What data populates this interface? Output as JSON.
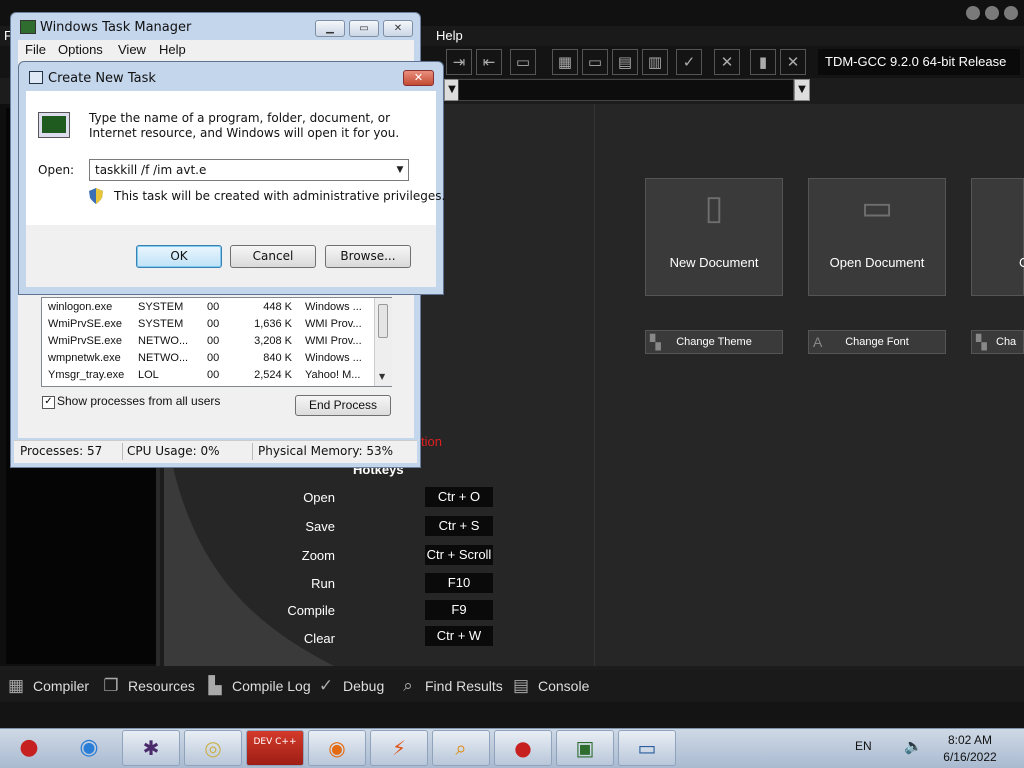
{
  "devcpp": {
    "menu": {
      "first": "F",
      "help": "Help"
    },
    "compiler": "TDM-GCC 9.2.0 64-bit Release",
    "cards": [
      {
        "label": "New Document",
        "icon": "new-document-icon"
      },
      {
        "label": "Open Document",
        "icon": "open-document-icon"
      },
      {
        "label": "C",
        "icon": "document-icon"
      }
    ],
    "small_buttons": [
      {
        "label": "Change Theme",
        "icon": "theme-icon"
      },
      {
        "label": "Change Font",
        "icon": "font-icon"
      },
      {
        "label": "Cha",
        "icon": "settings-icon"
      }
    ],
    "hotkeys_fragment": "tion",
    "hotkeys_title": "Hotkeys",
    "hotkeys": [
      {
        "action": "Open",
        "keys": "Ctr + O"
      },
      {
        "action": "Save",
        "keys": "Ctr + S"
      },
      {
        "action": "Zoom",
        "keys": "Ctr + Scroll"
      },
      {
        "action": "Run",
        "keys": "F10"
      },
      {
        "action": "Compile",
        "keys": "F9"
      },
      {
        "action": "Clear",
        "keys": "Ctr + W"
      }
    ],
    "bottom_tabs": [
      "Compiler",
      "Resources",
      "Compile Log",
      "Debug",
      "Find Results",
      "Console"
    ]
  },
  "task_manager": {
    "title": "Windows Task Manager",
    "menu": [
      "File",
      "Options",
      "View",
      "Help"
    ],
    "processes": [
      {
        "name": "winlogon.exe",
        "user": "SYSTEM",
        "cpu": "00",
        "mem": "448 K",
        "desc": "Windows ..."
      },
      {
        "name": "WmiPrvSE.exe",
        "user": "SYSTEM",
        "cpu": "00",
        "mem": "1,636 K",
        "desc": "WMI Prov..."
      },
      {
        "name": "WmiPrvSE.exe",
        "user": "NETWO...",
        "cpu": "00",
        "mem": "3,208 K",
        "desc": "WMI Prov..."
      },
      {
        "name": "wmpnetwk.exe",
        "user": "NETWO...",
        "cpu": "00",
        "mem": "840 K",
        "desc": "Windows ..."
      },
      {
        "name": "Ymsgr_tray.exe",
        "user": "LOL",
        "cpu": "00",
        "mem": "2,524 K",
        "desc": "Yahoo! M..."
      }
    ],
    "show_all_label": "Show processes from all users",
    "show_all_checked": true,
    "end_process_label": "End Process",
    "status": {
      "processes": "Processes: 57",
      "cpu": "CPU Usage: 0%",
      "memory": "Physical Memory: 53%"
    }
  },
  "new_task": {
    "title": "Create New Task",
    "description": "Type the name of a program, folder, document, or Internet resource, and Windows will open it for you.",
    "open_label": "Open:",
    "open_value": "taskkill /f /im avt.e",
    "admin_note": "This task will be created with administrative privileges.",
    "ok_label": "OK",
    "cancel_label": "Cancel",
    "browse_label": "Browse..."
  },
  "taskbar": {
    "language": "EN",
    "time": "8:02 AM",
    "date": "6/16/2022",
    "apps": [
      "angry-birds-start-icon",
      "chrome-icon",
      "spider-icon",
      "dvd-icon",
      "dev-cpp-icon",
      "firefox-icon",
      "power-icon",
      "search-app-icon",
      "angry-birds-icon",
      "task-manager-icon",
      "create-task-icon"
    ],
    "devcpp_badge": "DEV C++"
  }
}
